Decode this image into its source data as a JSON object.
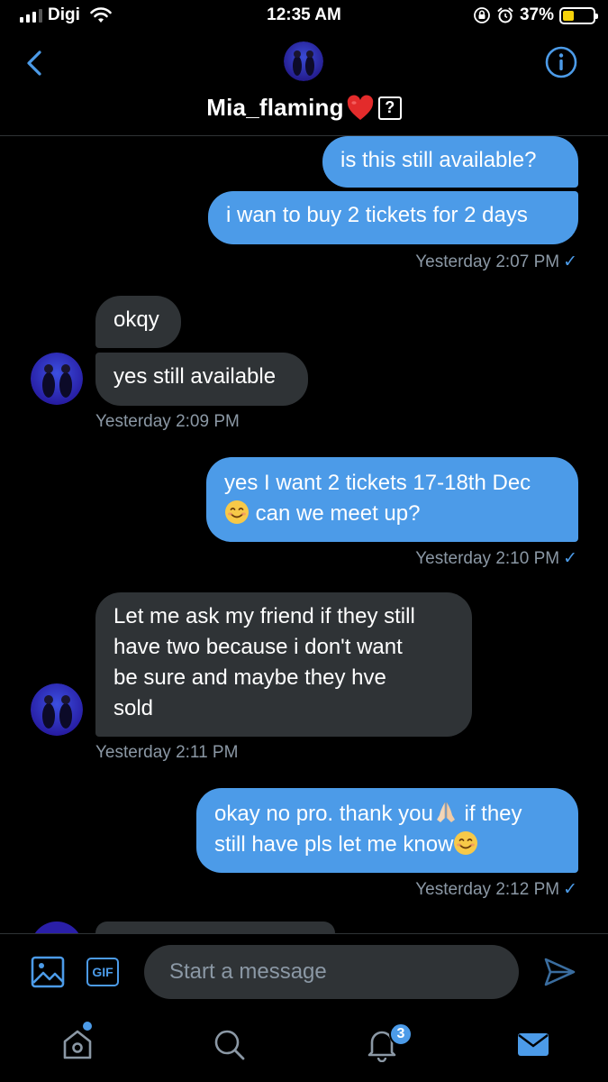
{
  "status_bar": {
    "carrier": "Digi",
    "time": "12:35 AM",
    "battery_percent": "37%",
    "battery_level": 0.37,
    "icons": [
      "signal-icon",
      "wifi-icon",
      "orientation-lock-icon",
      "alarm-icon",
      "battery-icon"
    ]
  },
  "header": {
    "title": "Mia_flaming",
    "title_emoji": "red-heart",
    "title_symbol": "?",
    "back_icon": "chevron-left-icon",
    "info_icon": "info-icon"
  },
  "messages": [
    {
      "side": "out",
      "text": "is this still available?"
    },
    {
      "side": "out",
      "text": "i wan to buy 2 tickets for 2 days"
    },
    {
      "timestamp": "Yesterday 2:07 PM",
      "status": "✓"
    },
    {
      "side": "in",
      "text": "okqy"
    },
    {
      "side": "in",
      "text": "yes still available"
    },
    {
      "timestamp": "Yesterday 2:09 PM"
    },
    {
      "side": "out",
      "text_line1": "yes I want 2 tickets 17-18th Dec",
      "text_line2": "can we meet up?"
    },
    {
      "timestamp": "Yesterday 2:10 PM",
      "status": "✓"
    },
    {
      "side": "in",
      "lines": [
        "Let me ask my friend if they still",
        "have two because i don't want",
        "be sure and maybe they hve",
        "sold"
      ]
    },
    {
      "timestamp": "Yesterday 2:11 PM"
    },
    {
      "side": "out",
      "line1_a": "okay no pro. thank you",
      "line1_b": " if they",
      "line2": "still have pls let me know"
    },
    {
      "timestamp": "Yesterday 2:12 PM",
      "status": "✓"
    }
  ],
  "compose": {
    "placeholder": "Start a message",
    "gif_label": "GIF"
  },
  "tab_bar": {
    "notifications_badge": "3",
    "tabs": [
      "home-icon",
      "search-icon",
      "notifications-icon",
      "messages-icon"
    ]
  },
  "colors": {
    "accent": "#4c9be8",
    "outgoing_bubble": "#4c9be8",
    "incoming_bubble": "#2f3336",
    "background": "#000000",
    "muted_text": "#8b98a5"
  }
}
